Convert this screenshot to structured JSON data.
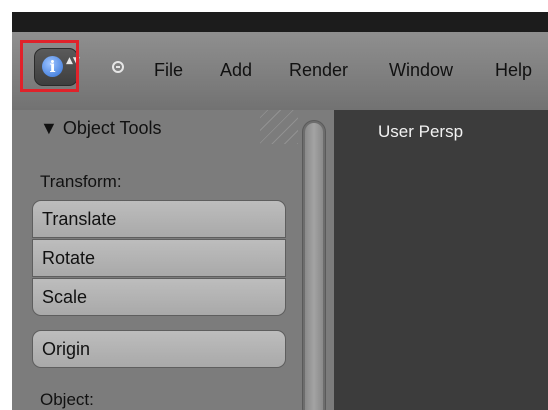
{
  "menubar": {
    "editor_type": {
      "info_icon": "info-icon",
      "info_glyph": "i",
      "updown_glyph": "▲▼"
    },
    "items": [
      "File",
      "Add",
      "Render",
      "Window",
      "Help"
    ]
  },
  "toolshelf": {
    "header": "▼ Object Tools",
    "sections": {
      "transform_label": "Transform:",
      "transform_buttons": [
        "Translate",
        "Rotate",
        "Scale"
      ],
      "origin_button": "Origin",
      "object_label": "Object:"
    }
  },
  "viewport": {
    "label": "User Persp"
  },
  "colors": {
    "highlight": "#e0222a",
    "menubar": "#7f7f7f",
    "toolshelf": "#7c7c7c",
    "viewport": "#3c3c3c"
  }
}
